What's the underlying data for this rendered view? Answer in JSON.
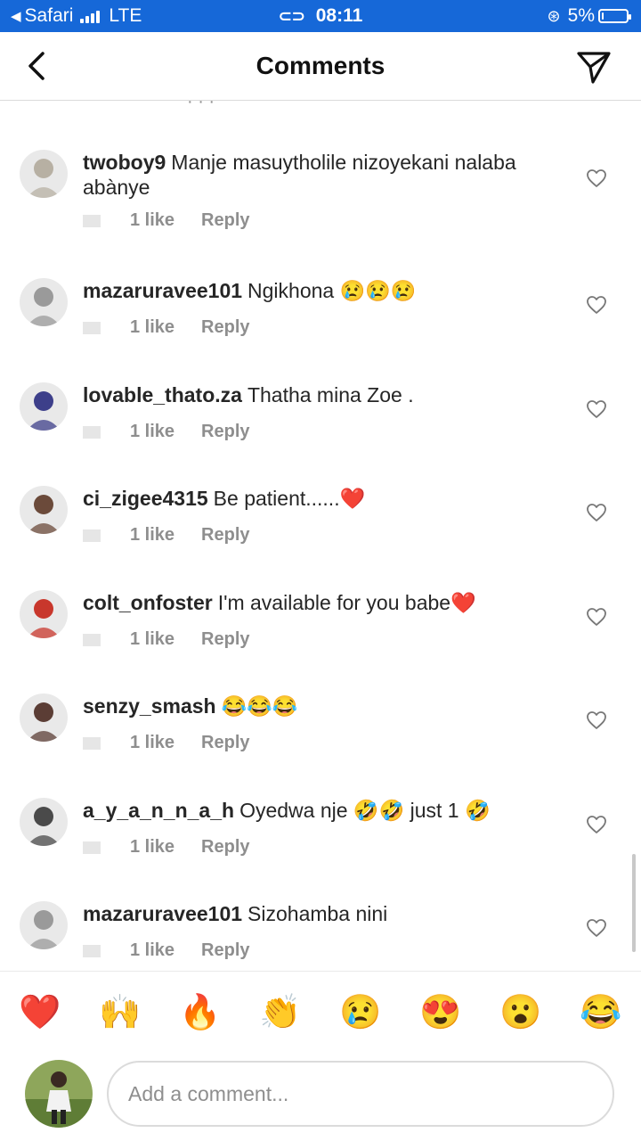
{
  "status_bar": {
    "carrier": "Safari",
    "network": "LTE",
    "time": "08:11",
    "battery": "5%",
    "battery_level": 0.05
  },
  "header": {
    "title": "Comments"
  },
  "comments": [
    {
      "username": "twoboy9",
      "text": "Manje masuytholile nizoyekani nalaba abànye",
      "likes": "1 like",
      "reply": "Reply",
      "avatar_color": "#b7b0a3"
    },
    {
      "username": "mazaruravee101",
      "text": "Ngikhona 😢😢😢",
      "likes": "1 like",
      "reply": "Reply",
      "avatar_color": "#9a9a9a"
    },
    {
      "username": "lovable_thato.za",
      "text": "Thatha mina Zoe .",
      "likes": "1 like",
      "reply": "Reply",
      "avatar_color": "#3d3f8a"
    },
    {
      "username": "ci_zigee4315",
      "text": "Be patient......❤️",
      "likes": "1 like",
      "reply": "Reply",
      "avatar_color": "#6b4a3a"
    },
    {
      "username": "colt_onfoster",
      "text": "I'm available for you babe❤️",
      "likes": "1 like",
      "reply": "Reply",
      "avatar_color": "#c8372c"
    },
    {
      "username": "senzy_smash",
      "text": "😂😂😂",
      "likes": "1 like",
      "reply": "Reply",
      "avatar_color": "#5b3d35"
    },
    {
      "username": "a_y_a_n_n_a_h",
      "text": "Oyedwa nje 🤣🤣 just 1 🤣",
      "likes": "1 like",
      "reply": "Reply",
      "avatar_color": "#4a4a4a"
    },
    {
      "username": "mazaruravee101",
      "text": "Sizohamba nini",
      "likes": "1 like",
      "reply": "Reply",
      "avatar_color": "#9a9a9a"
    }
  ],
  "emoji_bar": [
    "❤️",
    "🙌",
    "🔥",
    "👏",
    "😢",
    "😍",
    "😮",
    "😂"
  ],
  "composer": {
    "placeholder": "Add a comment..."
  }
}
